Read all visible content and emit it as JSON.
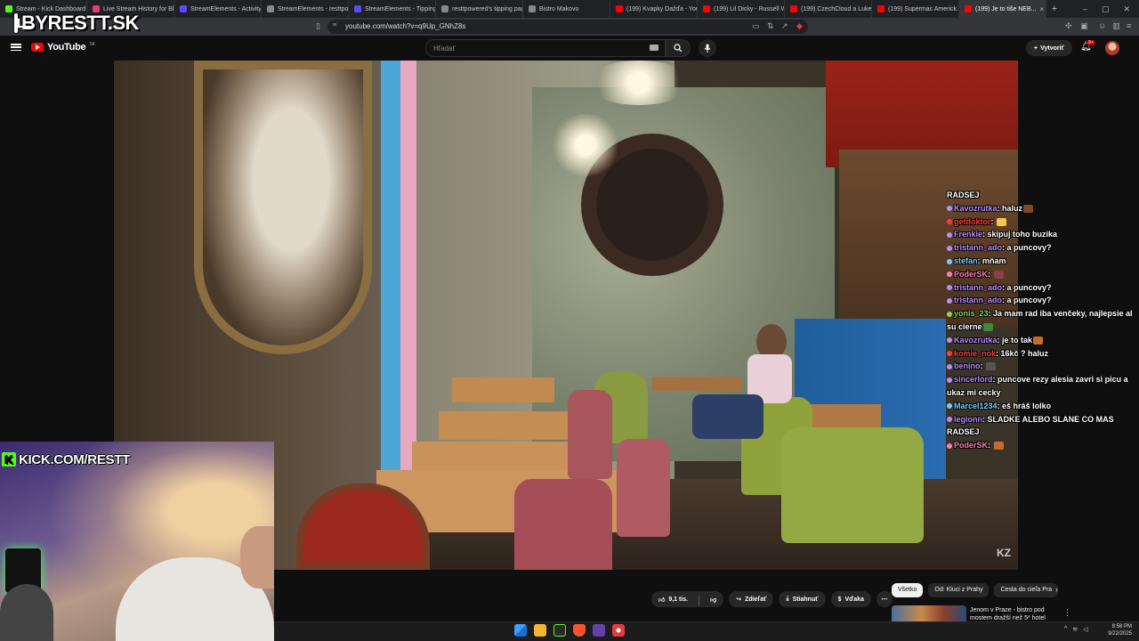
{
  "browser": {
    "tabs": [
      {
        "label": "Stream - Kick Dashboard",
        "color": "#53fc18"
      },
      {
        "label": "Live Stream History for Bl...",
        "color": "#e53b6f"
      },
      {
        "label": "StreamElements - Activity fe...",
        "color": "#5a4bff"
      },
      {
        "label": "StreamElements - resttpow...",
        "color": "#888888"
      },
      {
        "label": "StreamElements - Tipping",
        "color": "#5a4bff"
      },
      {
        "label": "resttpowered's tipping page",
        "color": "#888888"
      },
      {
        "label": "Bistro Makovo",
        "color": "#888888"
      },
      {
        "label": "(199) Kvapky Dažďa - YouT...",
        "color": "#ff0000"
      },
      {
        "label": "(199) Lil Dicky - Russell Wi...",
        "color": "#ff0000"
      },
      {
        "label": "(199) CzechCloud a Lukefy...",
        "color": "#ff0000"
      },
      {
        "label": "(199) Supermac Americk...",
        "color": "#ff0000"
      },
      {
        "label": "(199) Je to tiše NEB...",
        "color": "#ff0000",
        "active": true
      }
    ],
    "url": "youtube.com/watch?v=q9Up_GNhZ8s"
  },
  "overlay": {
    "logo_text": "BYRESTT.SK",
    "kick_text": "KICK.COM/RESTT"
  },
  "youtube": {
    "logo_word": "YouTube",
    "region": "SK",
    "search_placeholder": "Hľadať",
    "create_label": "Vytvoriť",
    "notif_count": "9+",
    "watermark": "KZ"
  },
  "chat": [
    {
      "text": "RADSEJ"
    },
    {
      "user": "Kavozrutka",
      "color": "#b78cff",
      "text": "haluz",
      "emote": "#7a4a2a"
    },
    {
      "user": "getdoktor",
      "color": "#ff3b3b",
      "text": "",
      "emote": "#f2c94c"
    },
    {
      "user": "Frenkie",
      "color": "#b78cff",
      "text": "skipuj toho buzika"
    },
    {
      "user": "tristann_ado",
      "color": "#b78cff",
      "text": "a puncovy?"
    },
    {
      "user": "stefan",
      "color": "#6fd0ff",
      "text": "mňam"
    },
    {
      "user": "PoderSK",
      "color": "#ff7eb3",
      "text": "",
      "emote": "#8a3f4a"
    },
    {
      "user": "tristann_ado",
      "color": "#b78cff",
      "text": "a puncovy?"
    },
    {
      "user": "tristann_ado",
      "color": "#b78cff",
      "text": "a puncovy?"
    },
    {
      "user": "yonis_23",
      "color": "#7ed957",
      "text": "Ja mam rad iba venčeky, najlepsie ak su cierne",
      "emote": "#3a8a3a"
    },
    {
      "user": "Kavozrutka",
      "color": "#b78cff",
      "text": "je to tak",
      "emote": "#c76b2a"
    },
    {
      "user": "komie_nok",
      "color": "#ff3b3b",
      "text": "16kč ? haluz"
    },
    {
      "user": "benino",
      "color": "#b78cff",
      "text": "",
      "emote": "#555555"
    },
    {
      "user": "sincerlord",
      "color": "#b78cff",
      "text": "puncove rezy alesia zavri si picu a ukaz mi cecky"
    },
    {
      "user": "Marcel1234",
      "color": "#6fd0ff",
      "text": "eš hráš lolko"
    },
    {
      "user": "legionn",
      "color": "#b78cff",
      "text": "SLADKE ALEBO SLANE CO MAS RADSEJ"
    },
    {
      "user": "PoderSK",
      "color": "#ff7eb3",
      "text": "",
      "emote": "#c76b2a"
    }
  ],
  "below": {
    "like_count": "9,1 tis.",
    "share": "Zdieľať",
    "download": "Stiahnuť",
    "thanks": "Vďaka",
    "chips": [
      {
        "label": "Všetko",
        "active": true
      },
      {
        "label": "Od: Kluci z Prahy"
      },
      {
        "label": "Cesta do cieľa Pra"
      }
    ],
    "rec_title": "Jenom v Praze - bistro pod mostem dražší než 5* hotel"
  },
  "taskbar": {
    "time": "8:58 PM",
    "date": "9/22/2025"
  }
}
